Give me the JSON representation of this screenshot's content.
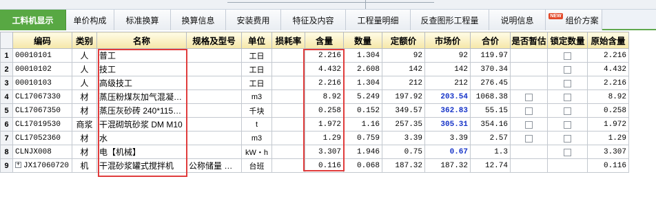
{
  "tabs": [
    {
      "label": "工料机显示",
      "active": true
    },
    {
      "label": "单价构成"
    },
    {
      "label": "标准换算"
    },
    {
      "label": "换算信息"
    },
    {
      "label": "安装费用"
    },
    {
      "label": "特征及内容"
    },
    {
      "label": "工程量明细"
    },
    {
      "label": "反查图形工程量"
    },
    {
      "label": "说明信息"
    },
    {
      "label": "组价方案",
      "badge": "NEW"
    }
  ],
  "columns": [
    "编码",
    "类别",
    "名称",
    "规格及型号",
    "单位",
    "损耗率",
    "含量",
    "数量",
    "定额价",
    "市场价",
    "合价",
    "是否暂估",
    "锁定数量",
    "原始含量"
  ],
  "rows": [
    {
      "no": "1",
      "code": "00010101",
      "type": "人",
      "name": "普工",
      "spec": "",
      "unit": "工日",
      "loss": "",
      "content": "2.216",
      "qty": "1.304",
      "quota": "92",
      "market": "92",
      "total": "119.97",
      "est": false,
      "lock": true,
      "orig": "2.216"
    },
    {
      "no": "2",
      "code": "00010102",
      "type": "人",
      "name": "技工",
      "spec": "",
      "unit": "工日",
      "loss": "",
      "content": "4.432",
      "qty": "2.608",
      "quota": "142",
      "market": "142",
      "total": "370.34",
      "est": false,
      "lock": true,
      "orig": "4.432"
    },
    {
      "no": "3",
      "code": "00010103",
      "type": "人",
      "name": "高级技工",
      "spec": "",
      "unit": "工日",
      "loss": "",
      "content": "2.216",
      "qty": "1.304",
      "quota": "212",
      "market": "212",
      "total": "276.45",
      "est": false,
      "lock": true,
      "orig": "2.216"
    },
    {
      "no": "4",
      "code": "CL17067330",
      "type": "材",
      "name": "蒸压粉煤灰加气混凝…",
      "spec": "",
      "unit": "m3",
      "loss": "",
      "content": "8.92",
      "qty": "5.249",
      "quota": "197.92",
      "market": "203.54",
      "marketBold": true,
      "total": "1068.38",
      "est": true,
      "lock": true,
      "orig": "8.92"
    },
    {
      "no": "5",
      "code": "CL17067350",
      "type": "材",
      "name": "蒸压灰砂砖 240*115…",
      "spec": "",
      "unit": "千块",
      "loss": "",
      "content": "0.258",
      "qty": "0.152",
      "quota": "349.57",
      "market": "362.83",
      "marketBold": true,
      "total": "55.15",
      "est": true,
      "lock": true,
      "orig": "0.258"
    },
    {
      "no": "6",
      "code": "CL17019530",
      "type": "商浆",
      "name": "干混砌筑砂浆 DM M10",
      "spec": "",
      "unit": "t",
      "loss": "",
      "content": "1.972",
      "qty": "1.16",
      "quota": "257.35",
      "market": "305.31",
      "marketBold": true,
      "total": "354.16",
      "est": true,
      "lock": true,
      "orig": "1.972"
    },
    {
      "no": "7",
      "code": "CL17052360",
      "type": "材",
      "name": "水",
      "spec": "",
      "unit": "m3",
      "loss": "",
      "content": "1.29",
      "qty": "0.759",
      "quota": "3.39",
      "market": "3.39",
      "total": "2.57",
      "est": true,
      "lock": true,
      "orig": "1.29"
    },
    {
      "no": "8",
      "code": "CLNJX008",
      "type": "材",
      "name": "电【机械】",
      "spec": "",
      "unit": "kW・h",
      "loss": "",
      "content": "3.307",
      "qty": "1.946",
      "quota": "0.75",
      "market": "0.67",
      "marketBold": true,
      "total": "1.3",
      "est": false,
      "lock": true,
      "orig": "3.307"
    },
    {
      "no": "9",
      "code": "JX17060720",
      "type": "机",
      "name": "干混砂浆罐式搅拌机",
      "spec": "公称储量 …",
      "unit": "台班",
      "loss": "",
      "content": "0.116",
      "qty": "0.068",
      "quota": "187.32",
      "market": "187.32",
      "total": "12.74",
      "est": false,
      "lock": false,
      "orig": "0.116",
      "expandable": true
    }
  ],
  "colors": {
    "active_tab": "#58a843",
    "highlight": "#e03b3b",
    "market_bold": "#1533c8",
    "header_bg": "#f5e7a8"
  }
}
